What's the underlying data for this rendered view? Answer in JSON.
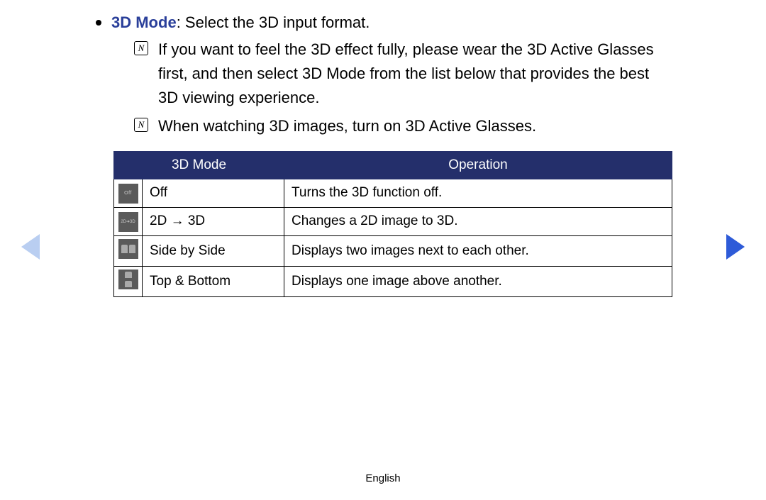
{
  "heading": {
    "label": "3D Mode",
    "rest": ": Select the 3D input format."
  },
  "notes": [
    "If you want to feel the 3D effect fully, please wear the 3D Active Glasses first, and then select 3D Mode from the list below that provides the best 3D viewing experience.",
    "When watching 3D images, turn on 3D Active Glasses."
  ],
  "table": {
    "headers": {
      "mode": "3D Mode",
      "operation": "Operation"
    },
    "rows": [
      {
        "icon": "off",
        "icon_text": "Off",
        "mode": "Off",
        "operation": "Turns the 3D function off."
      },
      {
        "icon": "2d3d",
        "icon_text": "2D➔3D",
        "mode": "2D → 3D",
        "operation": "Changes a 2D image to 3D."
      },
      {
        "icon": "sbs",
        "icon_text": "",
        "mode": "Side by Side",
        "operation": "Displays two images next to each other."
      },
      {
        "icon": "tb",
        "icon_text": "",
        "mode": "Top & Bottom",
        "operation": "Displays one image above another."
      }
    ]
  },
  "footer": {
    "language": "English"
  },
  "note_glyph": "N"
}
